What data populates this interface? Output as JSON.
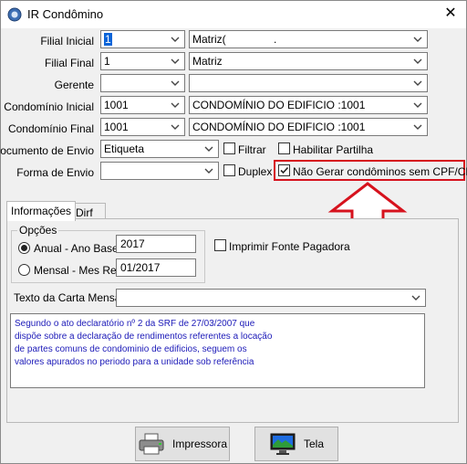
{
  "window": {
    "title": "IR Condômino",
    "close_glyph": "✕"
  },
  "fields": {
    "filial_inicial": {
      "label": "Filial Inicial",
      "code": "1",
      "name": "Matriz(",
      "name_suffix": "."
    },
    "filial_final": {
      "label": "Filial Final",
      "code": "1",
      "name": "Matriz"
    },
    "gerente": {
      "label": "Gerente",
      "code": "",
      "name": ""
    },
    "condominio_inicial": {
      "label": "Condomínio Inicial",
      "code": "1001",
      "name": "CONDOMÍNIO DO EDIFICIO :1001"
    },
    "condominio_final": {
      "label": "Condomínio Final",
      "code": "1001",
      "name": "CONDOMÍNIO DO EDIFICIO :1001"
    },
    "documento_envio": {
      "label": "Documento de Envio",
      "value": "Etiqueta"
    },
    "forma_envio": {
      "label": "Forma de Envio",
      "value": ""
    }
  },
  "checks": {
    "filtrar": {
      "label": "Filtrar",
      "checked": false
    },
    "habilitar_partilha": {
      "label": "Habilitar Partilha",
      "checked": false
    },
    "duplex": {
      "label": "Duplex",
      "checked": false
    },
    "nao_gerar": {
      "label": "Não Gerar condôminos sem CPF/CNPJ",
      "checked": true
    },
    "imprimir_fonte": {
      "label": "Imprimir Fonte Pagadora",
      "checked": false
    }
  },
  "tabs": [
    {
      "label": "Informações",
      "active": true
    },
    {
      "label": "Dirf",
      "active": false
    }
  ],
  "opcoes": {
    "title": "Opções",
    "anual": {
      "label": "Anual - Ano Base",
      "value": "2017",
      "selected": true
    },
    "mensal": {
      "label": "Mensal - Mes Ref.",
      "value": "01/2017",
      "selected": false
    }
  },
  "texto_carta": {
    "label": "Texto da Carta Mensal",
    "value": ""
  },
  "memo": {
    "lines": [
      "Segundo o ato declaratório nº 2 da SRF de 27/03/2007 que",
      "dispõe sobre a declaração de rendimentos referentes a locação",
      "de partes comuns de condominio de edificios, seguem os",
      "valores apurados no periodo para a unidade sob referência"
    ]
  },
  "buttons": {
    "impressora": {
      "label": "Impressora",
      "icon": "printer-icon"
    },
    "tela": {
      "label": "Tela",
      "icon": "monitor-icon"
    }
  },
  "colors": {
    "highlight": "#d6121d",
    "selection": "#0a64d8",
    "memo_text": "#1c1ab8"
  }
}
